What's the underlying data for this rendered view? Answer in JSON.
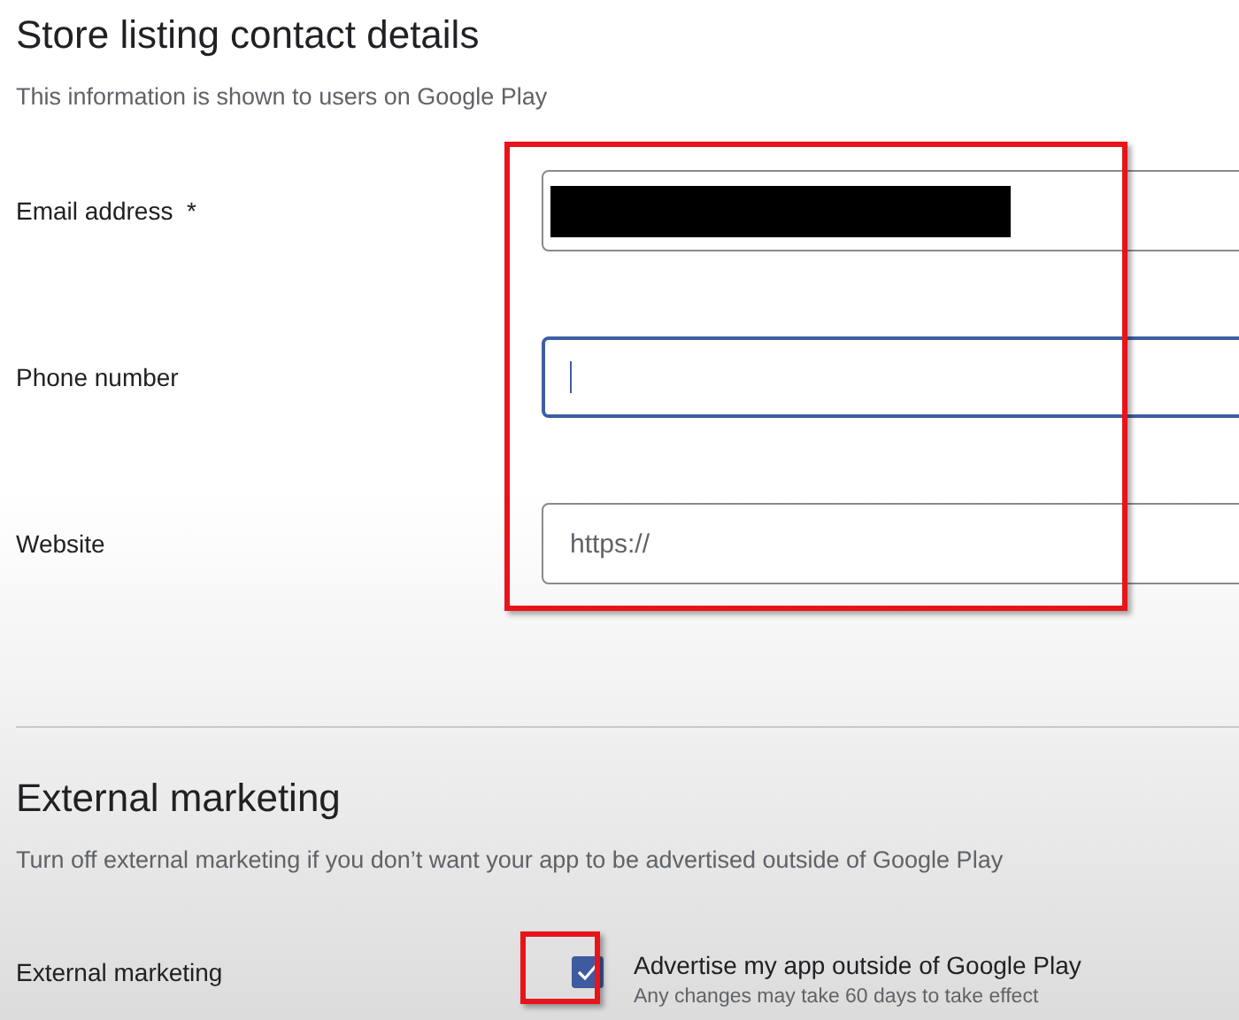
{
  "contact_section": {
    "title": "Store listing contact details",
    "description": "This information is shown to users on Google Play",
    "fields": [
      {
        "label": "Email address  *",
        "redacted": true,
        "focused": false
      },
      {
        "label": "Phone number",
        "redacted": false,
        "focused": true
      },
      {
        "label": "Website",
        "value": "https://",
        "redacted": false,
        "focused": false
      }
    ]
  },
  "marketing_section": {
    "title": "External marketing",
    "description": "Turn off external marketing if you don’t want your app to be advertised outside of Google Play",
    "row": {
      "label": "External marketing",
      "checkbox_label": "Advertise my app outside of Google Play",
      "hint": "Any changes may take 60 days to take effect",
      "checked": true
    }
  }
}
